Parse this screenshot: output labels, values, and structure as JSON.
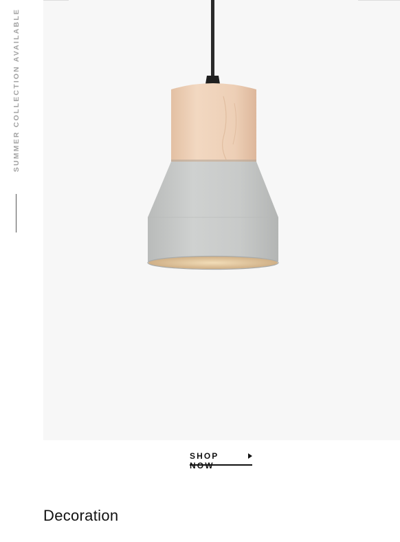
{
  "banner": {
    "side_text": "SUMMER COLLECTION AVAILABLE",
    "cta_label": "SHOP NOW",
    "cta_arrow_icon": "triangle-right-icon"
  },
  "section": {
    "title": "Decoration"
  },
  "colors": {
    "image_background": "#f7f7f7",
    "wood_shade": "#eccfb6",
    "concrete_shade": "#c6c8c7",
    "text_primary": "#111111",
    "text_muted": "#a3a3a3"
  }
}
